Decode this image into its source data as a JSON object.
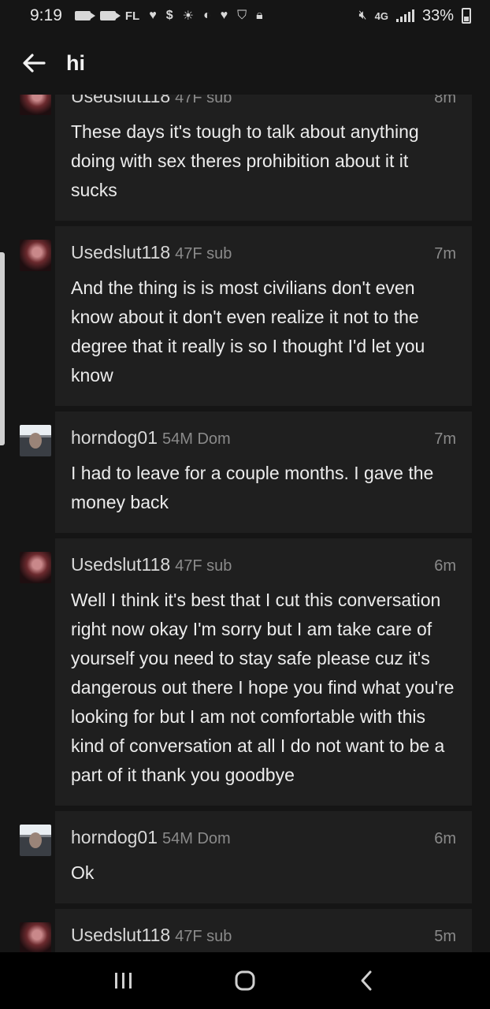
{
  "status_bar": {
    "time": "9:19",
    "carrier_label": "FL",
    "dollar": "$",
    "network": "4G",
    "battery": "33%"
  },
  "header": {
    "title": "hi"
  },
  "messages": [
    {
      "user": "Usedslut118",
      "meta": "47F sub",
      "time": "8m",
      "avatar": "female",
      "text": "These days it's tough to talk about anything doing with sex theres prohibition about it it sucks"
    },
    {
      "user": "Usedslut118",
      "meta": "47F sub",
      "time": "7m",
      "avatar": "female",
      "text": "And the thing is is most civilians don't even know about it don't even realize it not to the degree that it really is so I thought I'd let you know"
    },
    {
      "user": "horndog01",
      "meta": "54M Dom",
      "time": "7m",
      "avatar": "male",
      "text": "I had to leave for a couple months. I gave the money back"
    },
    {
      "user": "Usedslut118",
      "meta": "47F sub",
      "time": "6m",
      "avatar": "female",
      "text": "Well I think it's best that I cut this conversation right now okay I'm sorry but I am take care of yourself you need to stay safe please cuz it's dangerous out there I hope you find what you're looking for but I am not comfortable with this kind of conversation at all I do not want to be a part of it thank you goodbye"
    },
    {
      "user": "horndog01",
      "meta": "54M Dom",
      "time": "6m",
      "avatar": "male",
      "text": "Ok"
    },
    {
      "user": "Usedslut118",
      "meta": "47F sub",
      "time": "5m",
      "avatar": "female",
      "text": ""
    }
  ],
  "nav": {
    "recents_icon": "recents-icon",
    "home_icon": "home-icon",
    "back_icon": "back-icon"
  }
}
